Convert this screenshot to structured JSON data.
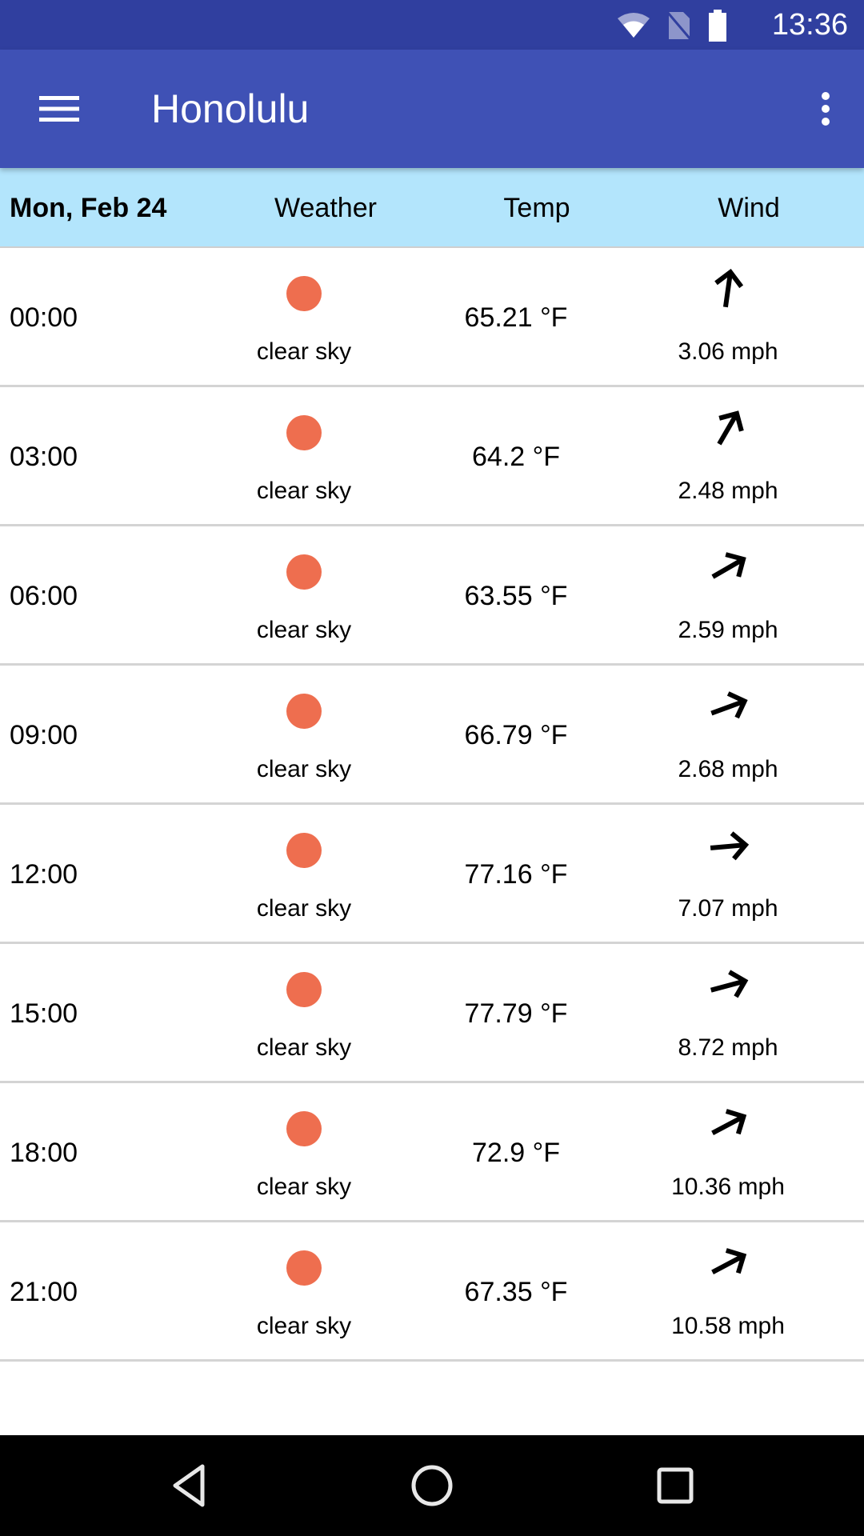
{
  "status_bar": {
    "time": "13:36",
    "icons": [
      "wifi-icon",
      "no-sim-icon",
      "battery-icon"
    ]
  },
  "app_bar": {
    "title": "Honolulu",
    "menu_icon": "hamburger-menu-icon",
    "overflow_icon": "more-vert-icon"
  },
  "table": {
    "header": {
      "date": "Mon, Feb 24",
      "weather": "Weather",
      "temp": "Temp",
      "wind": "Wind"
    },
    "rows": [
      {
        "time": "00:00",
        "weather": "clear sky",
        "temp": "65.21 °F",
        "wind_speed": "3.06 mph",
        "wind_dir_deg": 8
      },
      {
        "time": "03:00",
        "weather": "clear sky",
        "temp": "64.2 °F",
        "wind_speed": "2.48 mph",
        "wind_dir_deg": 30
      },
      {
        "time": "06:00",
        "weather": "clear sky",
        "temp": "63.55 °F",
        "wind_speed": "2.59 mph",
        "wind_dir_deg": 60
      },
      {
        "time": "09:00",
        "weather": "clear sky",
        "temp": "66.79 °F",
        "wind_speed": "2.68 mph",
        "wind_dir_deg": 70
      },
      {
        "time": "12:00",
        "weather": "clear sky",
        "temp": "77.16 °F",
        "wind_speed": "7.07 mph",
        "wind_dir_deg": 85
      },
      {
        "time": "15:00",
        "weather": "clear sky",
        "temp": "77.79 °F",
        "wind_speed": "8.72 mph",
        "wind_dir_deg": 75
      },
      {
        "time": "18:00",
        "weather": "clear sky",
        "temp": "72.9 °F",
        "wind_speed": "10.36 mph",
        "wind_dir_deg": 62
      },
      {
        "time": "21:00",
        "weather": "clear sky",
        "temp": "67.35 °F",
        "wind_speed": "10.58 mph",
        "wind_dir_deg": 62
      }
    ]
  },
  "colors": {
    "status_bar": "#303F9F",
    "app_bar": "#3F51B5",
    "header_bg": "#B3E5FC",
    "sun": "#EE6E4F"
  },
  "nav_bar": {
    "buttons": [
      "back-icon",
      "home-icon",
      "recents-icon"
    ]
  }
}
